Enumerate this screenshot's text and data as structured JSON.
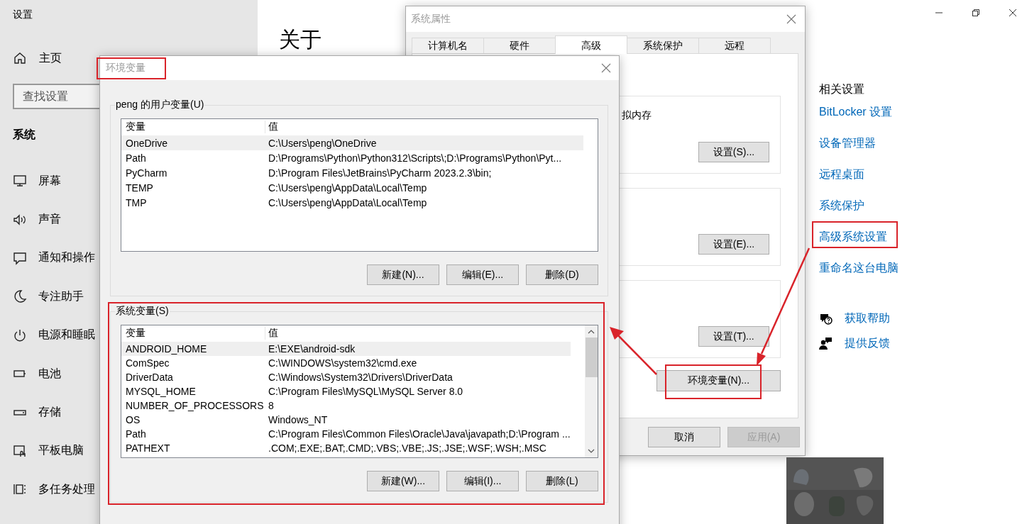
{
  "settings": {
    "title": "设置",
    "home": "主页",
    "search": {
      "placeholder": "查找设置"
    },
    "section": "系统",
    "nav_items": [
      {
        "label": "屏幕"
      },
      {
        "label": "声音"
      },
      {
        "label": "通知和操作"
      },
      {
        "label": "专注助手"
      },
      {
        "label": "电源和睡眠"
      },
      {
        "label": "电池"
      },
      {
        "label": "存储"
      },
      {
        "label": "平板电脑"
      },
      {
        "label": "多任务处理"
      }
    ],
    "heading": "关于",
    "related": {
      "title": "相关设置",
      "links": [
        "BitLocker 设置",
        "设备管理器",
        "远程桌面",
        "系统保护",
        "高级系统设置",
        "重命名这台电脑"
      ]
    },
    "help_links": [
      "获取帮助",
      "提供反馈"
    ]
  },
  "system_properties": {
    "title": "系统属性",
    "tabs": [
      {
        "label": "计算机名",
        "selected": false
      },
      {
        "label": "硬件",
        "selected": false
      },
      {
        "label": "高级",
        "selected": true
      },
      {
        "label": "系统保护",
        "selected": false
      },
      {
        "label": "远程",
        "selected": false
      }
    ],
    "group_text": "拟内存",
    "group_buttons": [
      "设置(S)...",
      "设置(E)...",
      "设置(T)..."
    ],
    "env_button": "环境变量(N)...",
    "footer_buttons": [
      {
        "label": "取消",
        "disabled": false
      },
      {
        "label": "应用(A)",
        "disabled": true
      }
    ]
  },
  "env_dialog": {
    "title": "环境变量",
    "groups": [
      {
        "label": "peng 的用户变量(U)",
        "columns": [
          "变量",
          "值"
        ],
        "scrollbar": false,
        "rows": [
          {
            "name": "OneDrive",
            "value": "C:\\Users\\peng\\OneDrive",
            "selected": true
          },
          {
            "name": "Path",
            "value": "D:\\Programs\\Python\\Python312\\Scripts\\;D:\\Programs\\Python\\Pyt...",
            "selected": false
          },
          {
            "name": "PyCharm",
            "value": "D:\\Program Files\\JetBrains\\PyCharm 2023.2.3\\bin;",
            "selected": false
          },
          {
            "name": "TEMP",
            "value": "C:\\Users\\peng\\AppData\\Local\\Temp",
            "selected": false
          },
          {
            "name": "TMP",
            "value": "C:\\Users\\peng\\AppData\\Local\\Temp",
            "selected": false
          }
        ],
        "buttons": [
          "新建(N)...",
          "编辑(E)...",
          "删除(D)"
        ]
      },
      {
        "label": "系统变量(S)",
        "columns": [
          "变量",
          "值"
        ],
        "scrollbar": true,
        "rows": [
          {
            "name": "ANDROID_HOME",
            "value": "E:\\EXE\\android-sdk",
            "selected": true
          },
          {
            "name": "ComSpec",
            "value": "C:\\WINDOWS\\system32\\cmd.exe",
            "selected": false
          },
          {
            "name": "DriverData",
            "value": "C:\\Windows\\System32\\Drivers\\DriverData",
            "selected": false
          },
          {
            "name": "MYSQL_HOME",
            "value": "C:\\Program Files\\MySQL\\MySQL Server 8.0",
            "selected": false
          },
          {
            "name": "NUMBER_OF_PROCESSORS",
            "value": "8",
            "selected": false
          },
          {
            "name": "OS",
            "value": "Windows_NT",
            "selected": false
          },
          {
            "name": "Path",
            "value": "C:\\Program Files\\Common Files\\Oracle\\Java\\javapath;D:\\Program ...",
            "selected": false
          },
          {
            "name": "PATHEXT",
            "value": ".COM;.EXE;.BAT;.CMD;.VBS;.VBE;.JS;.JSE;.WSF;.WSH;.MSC",
            "selected": false
          }
        ],
        "buttons": [
          "新建(W)...",
          "编辑(I)...",
          "删除(L)"
        ]
      }
    ]
  }
}
